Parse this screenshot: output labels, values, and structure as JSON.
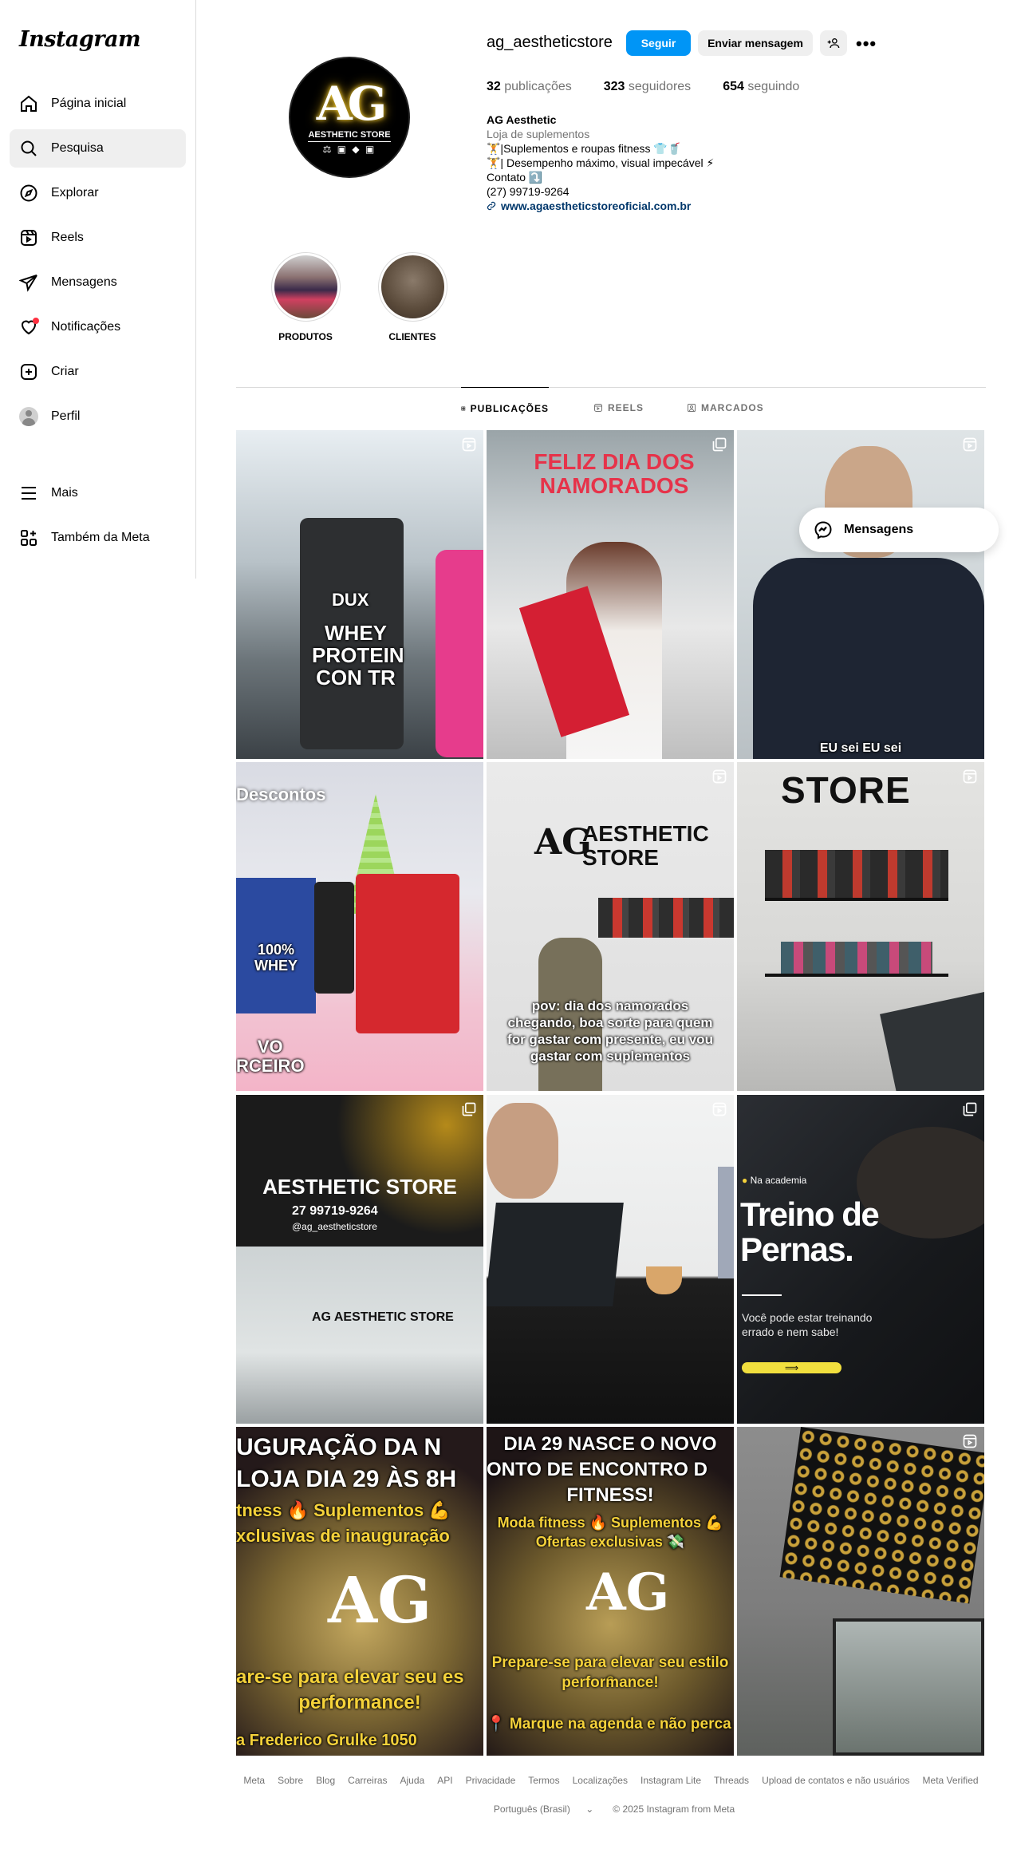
{
  "sidebar": {
    "logo": "Instagram",
    "items": [
      {
        "label": "Página inicial",
        "icon": "home-icon"
      },
      {
        "label": "Pesquisa",
        "icon": "search-icon"
      },
      {
        "label": "Explorar",
        "icon": "compass-icon"
      },
      {
        "label": "Reels",
        "icon": "reels-icon"
      },
      {
        "label": "Mensagens",
        "icon": "send-icon"
      },
      {
        "label": "Notificações",
        "icon": "heart-icon"
      },
      {
        "label": "Criar",
        "icon": "plus-square-icon"
      },
      {
        "label": "Perfil",
        "icon": "avatar"
      },
      {
        "label": "Mais",
        "icon": "menu-icon"
      },
      {
        "label": "Também da Meta",
        "icon": "meta-apps-icon"
      }
    ]
  },
  "profile": {
    "username": "ag_aestheticstore",
    "follow_label": "Seguir",
    "message_label": "Enviar mensagem",
    "pic_monogram": "AG",
    "pic_name": "AESTHETIC STORE",
    "stats": {
      "posts_num": "32",
      "posts_label": "publicações",
      "followers_num": "323",
      "followers_label": "seguidores",
      "following_num": "654",
      "following_label": "seguindo"
    },
    "bio": {
      "full_name": "AG Aesthetic",
      "category": "Loja de suplementos",
      "line1": "🏋️|Suplementos e roupas fitness 👕🥤",
      "line2": "🏋️| Desempenho máximo, visual impecável ⚡",
      "line3": "Contato ⤵️",
      "line4": "(27) 99719-9264",
      "link": "www.agaestheticstoreoficial.com.br"
    }
  },
  "highlights": [
    {
      "label": "PRODUTOS"
    },
    {
      "label": "CLIENTES"
    }
  ],
  "tabs": [
    {
      "label": "PUBLICAÇÕES"
    },
    {
      "label": "REELS"
    },
    {
      "label": "MARCADOS"
    }
  ],
  "posts": {
    "p3_caption": "EU sei EU sei",
    "p2_text": "FELIZ DIA DOS NAMORADOS",
    "p4_title": "Descontos",
    "p4_bottom": "VO\nRCEIRO",
    "p5_sign": "AESTHETIC STORE",
    "p5_caption": "pov: dia dos namorados chegando, boa sorte para quem for gastar com presente, eu vou gastar com suplementos",
    "p6_sign": "STORE",
    "p7_title": "AESTHETIC STORE",
    "p7_phone": "27 99719-9264",
    "p7_handle": "@ag_aestheticstore",
    "p9_tag": "Na academia",
    "p9_title": "Treino de Pernas.",
    "p9_sub": "Você pode estar treinando errado e nem sabe!",
    "p10_l1": "UGURAÇÃO DA N",
    "p10_l2": "LOJA DIA 29 ÀS 8H",
    "p10_l3": "tness 🔥 Suplementos 💪",
    "p10_l4": "xclusivas de inauguração",
    "p10_l5": "are-se para elevar seu es",
    "p10_l6": "performance!",
    "p10_l7": "a Frederico Grulke 1050",
    "p11_l1": "DIA 29 NASCE O NOVO",
    "p11_l2": "ONTO DE ENCONTRO D",
    "p11_l3": "FITNESS!",
    "p11_l4": "Moda fitness 🔥 Suplementos 💪",
    "p11_l5": "Ofertas exclusivas 💸",
    "p11_l6": "Prepare-se para elevar seu estilo e",
    "p11_l7": "performance!",
    "p11_l8": "📍 Marque na agenda e não perca",
    "p1_brand": "DUX",
    "p1_text": "WHEY PROTEIN CON TR",
    "p4_whey": "100% WHEY"
  },
  "messages_fab": "Mensagens",
  "footer": {
    "links": [
      "Meta",
      "Sobre",
      "Blog",
      "Carreiras",
      "Ajuda",
      "API",
      "Privacidade",
      "Termos",
      "Localizações",
      "Instagram Lite",
      "Threads",
      "Upload de contatos e não usuários",
      "Meta Verified"
    ],
    "language": "Português (Brasil)",
    "copyright": "© 2025 Instagram from Meta"
  },
  "colors": {
    "accent": "#0095f6",
    "notif": "#ff3040",
    "yellow": "#f5d23a"
  }
}
